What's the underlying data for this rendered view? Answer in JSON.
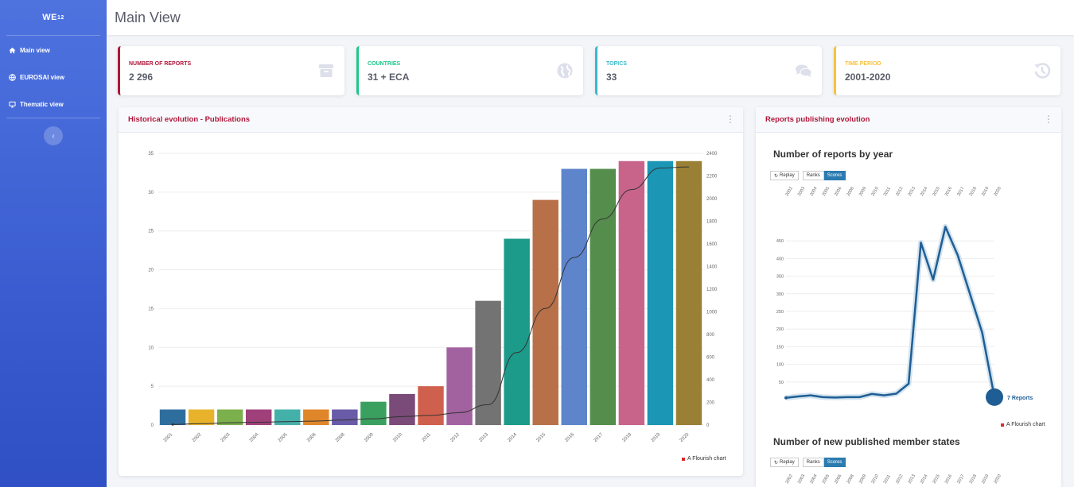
{
  "sidebar": {
    "brand": "WE",
    "brand_sup": "12",
    "items": [
      {
        "label": "Main view",
        "icon": "home-icon"
      },
      {
        "label": "EUROSAI view",
        "icon": "globe-icon"
      },
      {
        "label": "Thematic view",
        "icon": "monitor-icon"
      }
    ],
    "toggle_icon": "chevron-left-icon"
  },
  "header": {
    "title": "Main View"
  },
  "kpis": [
    {
      "label": "NUMBER OF REPORTS",
      "value": "2 296",
      "color": "#b0163a",
      "icon": "archive-icon"
    },
    {
      "label": "COUNTRIES",
      "value": "31 + ECA",
      "color": "#1cc88a",
      "icon": "globe-icon"
    },
    {
      "label": "TOPICS",
      "value": "33",
      "color": "#36b9cc",
      "icon": "comments-icon"
    },
    {
      "label": "TIME PERIOD",
      "value": "2001-2020",
      "color": "#f6c23e",
      "icon": "history-icon"
    }
  ],
  "panels": {
    "historical": {
      "title": "Historical evolution - Publications",
      "credit": "A Flourish chart"
    },
    "publishing": {
      "title": "Reports publishing evolution",
      "chart1_title": "Number of reports by year",
      "chart2_title": "Number of new published member states",
      "replay": "Replay",
      "ranks": "Ranks",
      "scores": "Scores",
      "end_label": "7 Reports",
      "credit": "A Flourish chart"
    }
  },
  "chart_data": [
    {
      "type": "bar",
      "categories": [
        "2001",
        "2002",
        "2003",
        "2004",
        "2005",
        "2006",
        "2008",
        "2009",
        "2010",
        "2011",
        "2012",
        "2013",
        "2014",
        "2015",
        "2016",
        "2017",
        "2018",
        "2019",
        "2020"
      ],
      "values": [
        2,
        2,
        2,
        2,
        2,
        2,
        2,
        3,
        4,
        5,
        10,
        16,
        24,
        29,
        33,
        33,
        34,
        34,
        34
      ],
      "colors": [
        "#2e6e9e",
        "#e8b32a",
        "#7bb04c",
        "#a0407a",
        "#44b0aa",
        "#e0862a",
        "#6a5ba8",
        "#3aa060",
        "#7a4a78",
        "#d0604e",
        "#a262a0",
        "#737373",
        "#1c9a8a",
        "#b87048",
        "#5e84cc",
        "#558e4c",
        "#c8648a",
        "#1b96b4",
        "#9a8034"
      ],
      "ylim": [
        0,
        35
      ],
      "yticks": [
        0,
        5,
        10,
        15,
        20,
        25,
        30,
        35
      ],
      "y2ticks": [
        0,
        200,
        400,
        600,
        800,
        1000,
        1200,
        1400,
        1600,
        1800,
        2000,
        2200,
        2400
      ],
      "y2lim": [
        0,
        2400
      ],
      "line": {
        "x": [
          "2001",
          "2002",
          "2003",
          "2004",
          "2005",
          "2006",
          "2008",
          "2009",
          "2010",
          "2011",
          "2012",
          "2013",
          "2014",
          "2015",
          "2016",
          "2017",
          "2018",
          "2019",
          "2020"
        ],
        "values": [
          5,
          12,
          20,
          25,
          30,
          35,
          45,
          55,
          75,
          85,
          110,
          180,
          640,
          1030,
          1480,
          1820,
          2080,
          2270,
          2280
        ]
      }
    },
    {
      "type": "line",
      "x": [
        "2002",
        "2003",
        "2004",
        "2005",
        "2006",
        "2008",
        "2009",
        "2010",
        "2011",
        "2012",
        "2013",
        "2014",
        "2015",
        "2016",
        "2017",
        "2018",
        "2019",
        "2020"
      ],
      "values": [
        5,
        9,
        12,
        7,
        6,
        7,
        7,
        16,
        12,
        17,
        45,
        445,
        340,
        490,
        410,
        300,
        190,
        7
      ],
      "ylim": [
        0,
        500
      ],
      "yticks": [
        50,
        100,
        150,
        200,
        250,
        300,
        350,
        400,
        450
      ]
    },
    {
      "type": "line",
      "x": [
        "2002",
        "2003",
        "2004",
        "2005",
        "2006",
        "2008",
        "2009",
        "2010",
        "2011",
        "2012",
        "2013",
        "2014",
        "2015",
        "2016",
        "2017",
        "2018",
        "2019",
        "2020"
      ]
    }
  ]
}
